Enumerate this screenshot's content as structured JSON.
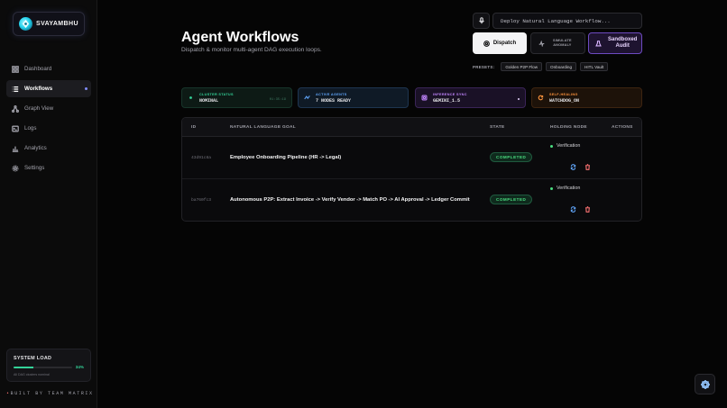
{
  "app": {
    "name": "SVAYAMBHU"
  },
  "sidebar": {
    "items": [
      {
        "label": "Dashboard",
        "icon": "grid-icon"
      },
      {
        "label": "Workflows",
        "icon": "list-icon",
        "active": true
      },
      {
        "label": "Graph View",
        "icon": "graph-icon"
      },
      {
        "label": "Logs",
        "icon": "terminal-icon"
      },
      {
        "label": "Analytics",
        "icon": "chart-icon"
      },
      {
        "label": "Settings",
        "icon": "gear-icon"
      }
    ],
    "system_load": {
      "title": "SYSTEM LOAD",
      "percent_label": "34%",
      "value": 0.34,
      "note": "All DAG clusters nominal"
    },
    "footer": {
      "prefix": "•",
      "text": "BUILT BY TEAM MATRIX"
    }
  },
  "header": {
    "title": "Agent Workflows",
    "subtitle": "Dispatch & monitor multi-agent DAG execution loops."
  },
  "command": {
    "placeholder": "Deploy Natural Language Workflow...",
    "dispatch_label": "Dispatch",
    "anomaly_line1": "SIMULATE",
    "anomaly_line2": "ANOMALY",
    "sandbox_line1": "Sandboxed",
    "sandbox_line2": "Audit",
    "presets_label": "PRESETS:",
    "presets": [
      "Golden P2P Flow",
      "Onboarding",
      "HITL Vault"
    ]
  },
  "stats": {
    "cluster": {
      "label": "CLUSTER STATUS",
      "value": "NOMINAL",
      "time": "01:35:19"
    },
    "agents": {
      "label": "ACTIVE AGENTS",
      "value": "7 NODES READY"
    },
    "sync": {
      "label": "INFERENCE SYNC",
      "value": "GEMINI_1.5"
    },
    "heal": {
      "label": "SELF-HEALING",
      "value": "WATCHDOG_ON"
    }
  },
  "table": {
    "columns": {
      "id": "ID",
      "goal": "NATURAL LANGUAGE GOAL",
      "state": "STATE",
      "node": "HOLDING NODE",
      "actions": "ACTIONS"
    },
    "rows": [
      {
        "id": "43d91c8a",
        "goal": "Employee Onboarding Pipeline (HR -> Legal)",
        "state": "COMPLETED",
        "node": "Verification"
      },
      {
        "id": "ba760fc3",
        "goal": "Autonomous P2P: Extract Invoice -> Verify Vendor -> Match PO -> AI Approval -> Ledger Commit",
        "state": "COMPLETED",
        "node": "Verification"
      }
    ]
  },
  "colors": {
    "accent": "#818cf8",
    "success": "#4ade80",
    "danger": "#f87171",
    "purple": "#c084fc",
    "orange": "#fb923c",
    "blue": "#60a5fa"
  }
}
